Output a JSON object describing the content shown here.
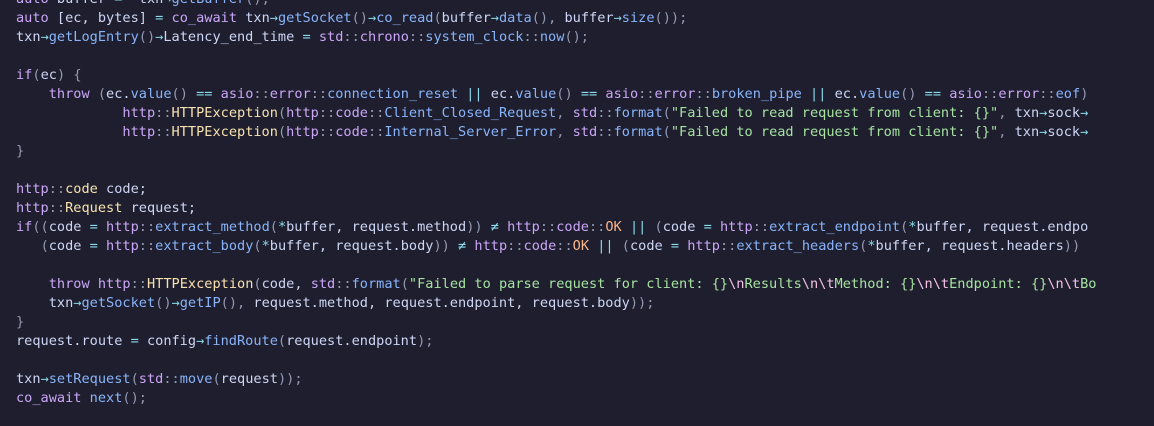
{
  "editor": {
    "colors": {
      "background": "#1e1e2e",
      "text": "#cdd6f4",
      "keyword": "#cba6f7",
      "function": "#89b4fa",
      "type": "#f9e2af",
      "namespace": "#cba6f7",
      "constant": "#fab387",
      "string": "#a6e3a1",
      "escape": "#f5c2e7",
      "punctuation": "#9399b2",
      "operator": "#89dceb"
    },
    "lines": [
      [
        [
          "kw",
          "auto"
        ],
        [
          "tx",
          " buffer "
        ],
        [
          "op",
          "="
        ],
        [
          "tx",
          "  txn"
        ],
        [
          "op",
          "→"
        ],
        [
          "fn",
          "getBuffer"
        ],
        [
          "pu",
          "();"
        ]
      ],
      [
        [
          "kw",
          "auto"
        ],
        [
          "tx",
          " [ec, bytes] "
        ],
        [
          "op",
          "="
        ],
        [
          "tx",
          " "
        ],
        [
          "kw",
          "co_await"
        ],
        [
          "tx",
          " txn"
        ],
        [
          "op",
          "→"
        ],
        [
          "fn",
          "getSocket"
        ],
        [
          "pu",
          "()"
        ],
        [
          "op",
          "→"
        ],
        [
          "fn",
          "co_read"
        ],
        [
          "pu",
          "("
        ],
        [
          "tx",
          "buffer"
        ],
        [
          "op",
          "→"
        ],
        [
          "fn",
          "data"
        ],
        [
          "pu",
          "(),"
        ],
        [
          "tx",
          " buffer"
        ],
        [
          "op",
          "→"
        ],
        [
          "fn",
          "size"
        ],
        [
          "pu",
          "());"
        ]
      ],
      [
        [
          "tx",
          "txn"
        ],
        [
          "op",
          "→"
        ],
        [
          "fn",
          "getLogEntry"
        ],
        [
          "pu",
          "()"
        ],
        [
          "op",
          "→"
        ],
        [
          "tx",
          "Latency_end_time "
        ],
        [
          "op",
          "="
        ],
        [
          "tx",
          " "
        ],
        [
          "ns",
          "std"
        ],
        [
          "pu",
          "::"
        ],
        [
          "ns",
          "chrono"
        ],
        [
          "pu",
          "::"
        ],
        [
          "fn",
          "system_clock"
        ],
        [
          "pu",
          "::"
        ],
        [
          "fn",
          "now"
        ],
        [
          "pu",
          "();"
        ]
      ],
      [],
      [
        [
          "kw",
          "if"
        ],
        [
          "pu",
          "("
        ],
        [
          "tx",
          "ec"
        ],
        [
          "pu",
          ")"
        ],
        [
          "tx",
          " "
        ],
        [
          "pu",
          "{"
        ]
      ],
      [
        [
          "tx",
          "    "
        ],
        [
          "kw",
          "throw"
        ],
        [
          "tx",
          " "
        ],
        [
          "pu",
          "("
        ],
        [
          "tx",
          "ec."
        ],
        [
          "fn",
          "value"
        ],
        [
          "pu",
          "()"
        ],
        [
          "tx",
          " "
        ],
        [
          "op",
          "=="
        ],
        [
          "tx",
          " "
        ],
        [
          "ns",
          "asio"
        ],
        [
          "pu",
          "::"
        ],
        [
          "ns",
          "error"
        ],
        [
          "pu",
          "::"
        ],
        [
          "fn",
          "connection_reset"
        ],
        [
          "tx",
          " "
        ],
        [
          "op",
          "||"
        ],
        [
          "tx",
          " ec."
        ],
        [
          "fn",
          "value"
        ],
        [
          "pu",
          "()"
        ],
        [
          "tx",
          " "
        ],
        [
          "op",
          "=="
        ],
        [
          "tx",
          " "
        ],
        [
          "ns",
          "asio"
        ],
        [
          "pu",
          "::"
        ],
        [
          "ns",
          "error"
        ],
        [
          "pu",
          "::"
        ],
        [
          "fn",
          "broken_pipe"
        ],
        [
          "tx",
          " "
        ],
        [
          "op",
          "||"
        ],
        [
          "tx",
          " ec."
        ],
        [
          "fn",
          "value"
        ],
        [
          "pu",
          "()"
        ],
        [
          "tx",
          " "
        ],
        [
          "op",
          "=="
        ],
        [
          "tx",
          " "
        ],
        [
          "ns",
          "asio"
        ],
        [
          "pu",
          "::"
        ],
        [
          "ns",
          "error"
        ],
        [
          "pu",
          "::"
        ],
        [
          "fn",
          "eof"
        ],
        [
          "pu",
          ")"
        ]
      ],
      [
        [
          "tx",
          "             "
        ],
        [
          "ns",
          "http"
        ],
        [
          "pu",
          "::"
        ],
        [
          "ty",
          "HTTPException"
        ],
        [
          "pu",
          "("
        ],
        [
          "ns",
          "http"
        ],
        [
          "pu",
          "::"
        ],
        [
          "ns",
          "code"
        ],
        [
          "pu",
          "::"
        ],
        [
          "fn",
          "Client_Closed_Request"
        ],
        [
          "pu",
          ","
        ],
        [
          "tx",
          " "
        ],
        [
          "ns",
          "std"
        ],
        [
          "pu",
          "::"
        ],
        [
          "fn",
          "format"
        ],
        [
          "pu",
          "("
        ],
        [
          "st",
          "\"Failed to read request from client: {}\""
        ],
        [
          "pu",
          ","
        ],
        [
          "tx",
          " txn"
        ],
        [
          "op",
          "→"
        ],
        [
          "tx",
          "sock"
        ],
        [
          "op",
          "→"
        ]
      ],
      [
        [
          "tx",
          "             "
        ],
        [
          "ns",
          "http"
        ],
        [
          "pu",
          "::"
        ],
        [
          "ty",
          "HTTPException"
        ],
        [
          "pu",
          "("
        ],
        [
          "ns",
          "http"
        ],
        [
          "pu",
          "::"
        ],
        [
          "ns",
          "code"
        ],
        [
          "pu",
          "::"
        ],
        [
          "fn",
          "Internal_Server_Error"
        ],
        [
          "pu",
          ","
        ],
        [
          "tx",
          " "
        ],
        [
          "ns",
          "std"
        ],
        [
          "pu",
          "::"
        ],
        [
          "fn",
          "format"
        ],
        [
          "pu",
          "("
        ],
        [
          "st",
          "\"Failed to read request from client: {}\""
        ],
        [
          "pu",
          ","
        ],
        [
          "tx",
          " txn"
        ],
        [
          "op",
          "→"
        ],
        [
          "tx",
          "sock"
        ],
        [
          "op",
          "→"
        ]
      ],
      [
        [
          "pu",
          "}"
        ]
      ],
      [],
      [
        [
          "ns",
          "http"
        ],
        [
          "pu",
          "::"
        ],
        [
          "ty",
          "code"
        ],
        [
          "tx",
          " code;"
        ]
      ],
      [
        [
          "ns",
          "http"
        ],
        [
          "pu",
          "::"
        ],
        [
          "ty",
          "Request"
        ],
        [
          "tx",
          " request;"
        ]
      ],
      [
        [
          "kw",
          "if"
        ],
        [
          "pu",
          "(("
        ],
        [
          "tx",
          "code "
        ],
        [
          "op",
          "="
        ],
        [
          "tx",
          " "
        ],
        [
          "ns",
          "http"
        ],
        [
          "pu",
          "::"
        ],
        [
          "fn",
          "extract_method"
        ],
        [
          "pu",
          "("
        ],
        [
          "op",
          "*"
        ],
        [
          "tx",
          "buffer, request.method"
        ],
        [
          "pu",
          "))"
        ],
        [
          "tx",
          " "
        ],
        [
          "op",
          "≠"
        ],
        [
          "tx",
          " "
        ],
        [
          "ns",
          "http"
        ],
        [
          "pu",
          "::"
        ],
        [
          "ns",
          "code"
        ],
        [
          "pu",
          "::"
        ],
        [
          "ac",
          "OK"
        ],
        [
          "tx",
          " "
        ],
        [
          "op",
          "||"
        ],
        [
          "tx",
          " "
        ],
        [
          "pu",
          "("
        ],
        [
          "tx",
          "code "
        ],
        [
          "op",
          "="
        ],
        [
          "tx",
          " "
        ],
        [
          "ns",
          "http"
        ],
        [
          "pu",
          "::"
        ],
        [
          "fn",
          "extract_endpoint"
        ],
        [
          "pu",
          "("
        ],
        [
          "op",
          "*"
        ],
        [
          "tx",
          "buffer, request.endpo"
        ]
      ],
      [
        [
          "tx",
          "   "
        ],
        [
          "pu",
          "("
        ],
        [
          "tx",
          "code "
        ],
        [
          "op",
          "="
        ],
        [
          "tx",
          " "
        ],
        [
          "ns",
          "http"
        ],
        [
          "pu",
          "::"
        ],
        [
          "fn",
          "extract_body"
        ],
        [
          "pu",
          "("
        ],
        [
          "op",
          "*"
        ],
        [
          "tx",
          "buffer, request.body"
        ],
        [
          "pu",
          "))"
        ],
        [
          "tx",
          " "
        ],
        [
          "op",
          "≠"
        ],
        [
          "tx",
          " "
        ],
        [
          "ns",
          "http"
        ],
        [
          "pu",
          "::"
        ],
        [
          "ns",
          "code"
        ],
        [
          "pu",
          "::"
        ],
        [
          "ac",
          "OK"
        ],
        [
          "tx",
          " "
        ],
        [
          "op",
          "||"
        ],
        [
          "tx",
          " "
        ],
        [
          "pu",
          "("
        ],
        [
          "tx",
          "code "
        ],
        [
          "op",
          "="
        ],
        [
          "tx",
          " "
        ],
        [
          "ns",
          "http"
        ],
        [
          "pu",
          "::"
        ],
        [
          "fn",
          "extract_headers"
        ],
        [
          "pu",
          "("
        ],
        [
          "op",
          "*"
        ],
        [
          "tx",
          "buffer, request.headers"
        ],
        [
          "pu",
          "))"
        ]
      ],
      [],
      [
        [
          "tx",
          "    "
        ],
        [
          "kw",
          "throw"
        ],
        [
          "tx",
          " "
        ],
        [
          "ns",
          "http"
        ],
        [
          "pu",
          "::"
        ],
        [
          "ty",
          "HTTPException"
        ],
        [
          "pu",
          "("
        ],
        [
          "tx",
          "code, "
        ],
        [
          "ns",
          "std"
        ],
        [
          "pu",
          "::"
        ],
        [
          "fn",
          "format"
        ],
        [
          "pu",
          "("
        ],
        [
          "st",
          "\"Failed to parse request for client: {}"
        ],
        [
          "es",
          "\\n"
        ],
        [
          "st",
          "Results"
        ],
        [
          "es",
          "\\n\\t"
        ],
        [
          "st",
          "Method: {}"
        ],
        [
          "es",
          "\\n\\t"
        ],
        [
          "st",
          "Endpoint: {}"
        ],
        [
          "es",
          "\\n\\t"
        ],
        [
          "st",
          "Bo"
        ]
      ],
      [
        [
          "tx",
          "    txn"
        ],
        [
          "op",
          "→"
        ],
        [
          "fn",
          "getSocket"
        ],
        [
          "pu",
          "()"
        ],
        [
          "op",
          "→"
        ],
        [
          "fn",
          "getIP"
        ],
        [
          "pu",
          "(),"
        ],
        [
          "tx",
          " request.method, request.endpoint, request.body"
        ],
        [
          "pu",
          "));"
        ]
      ],
      [
        [
          "pu",
          "}"
        ]
      ],
      [
        [
          "tx",
          "request.route "
        ],
        [
          "op",
          "="
        ],
        [
          "tx",
          " config"
        ],
        [
          "op",
          "→"
        ],
        [
          "fn",
          "findRoute"
        ],
        [
          "pu",
          "("
        ],
        [
          "tx",
          "request.endpoint"
        ],
        [
          "pu",
          ");"
        ]
      ],
      [],
      [
        [
          "tx",
          "txn"
        ],
        [
          "op",
          "→"
        ],
        [
          "fn",
          "setRequest"
        ],
        [
          "pu",
          "("
        ],
        [
          "ns",
          "std"
        ],
        [
          "pu",
          "::"
        ],
        [
          "fn",
          "move"
        ],
        [
          "pu",
          "("
        ],
        [
          "tx",
          "request"
        ],
        [
          "pu",
          "));"
        ]
      ],
      [
        [
          "kw",
          "co_await"
        ],
        [
          "tx",
          " "
        ],
        [
          "fn",
          "next"
        ],
        [
          "pu",
          "();"
        ]
      ]
    ]
  }
}
